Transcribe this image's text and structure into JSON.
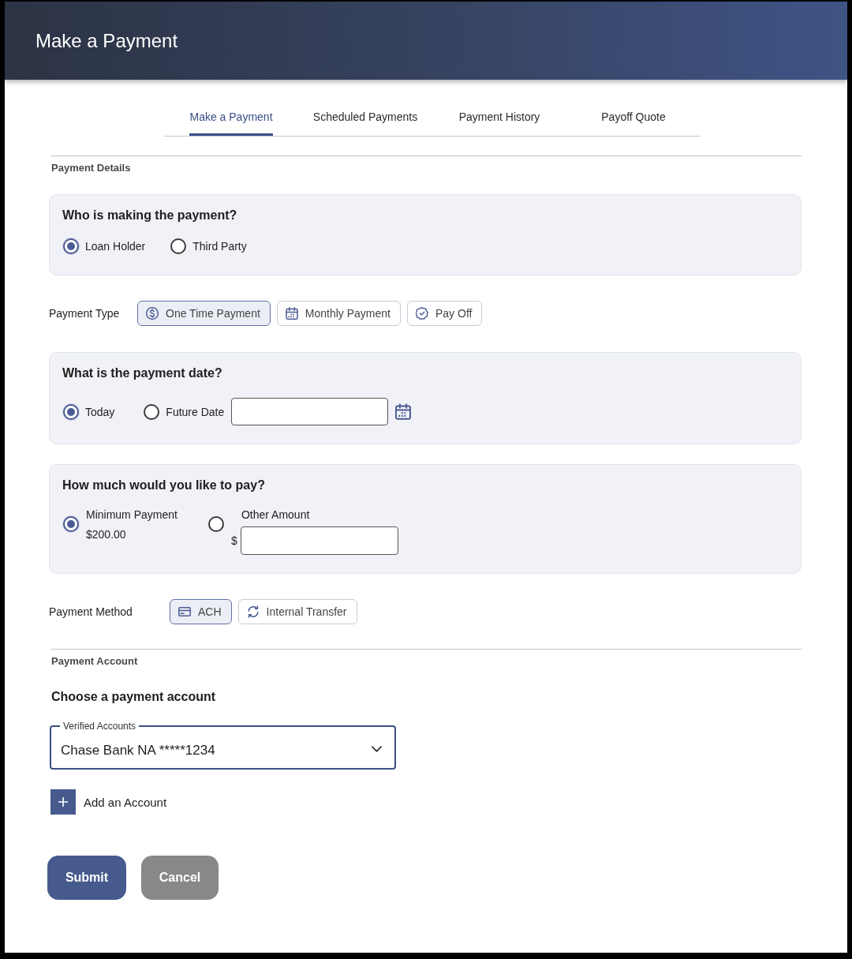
{
  "header": {
    "title": "Make a Payment"
  },
  "tabs": [
    {
      "label": "Make a Payment",
      "selected": true
    },
    {
      "label": "Scheduled Payments",
      "selected": false
    },
    {
      "label": "Payment History",
      "selected": false
    },
    {
      "label": "Payoff Quote",
      "selected": false
    }
  ],
  "payment_details": {
    "heading": "Payment Details",
    "payer": {
      "question": "Who is making the payment?",
      "options": [
        {
          "label": "Loan Holder",
          "selected": true
        },
        {
          "label": "Third Party",
          "selected": false
        }
      ]
    },
    "payment_type": {
      "label": "Payment Type",
      "options": [
        {
          "label": "One Time Payment",
          "selected": true
        },
        {
          "label": "Monthly Payment",
          "selected": false
        },
        {
          "label": "Pay Off",
          "selected": false
        }
      ]
    },
    "payment_date": {
      "question": "What is the payment date?",
      "options": [
        {
          "kind": "plain",
          "label": "Today",
          "selected": true
        },
        {
          "kind": "date",
          "label": "Future Date",
          "selected": false
        }
      ]
    },
    "amount": {
      "question": "How much would you like to pay?",
      "options": [
        {
          "kind": "value",
          "label": "Minimum Payment",
          "amount": "$200.00",
          "selected": true
        },
        {
          "kind": "input",
          "label": "Other Amount",
          "currency": "$",
          "selected": false
        }
      ]
    },
    "payment_method": {
      "label": "Payment Method",
      "options": [
        {
          "label": "ACH",
          "selected": true
        },
        {
          "label": "Internal Transfer",
          "selected": false
        }
      ]
    }
  },
  "payment_account": {
    "heading": "Payment Account",
    "prompt": "Choose a payment account",
    "account_select": {
      "label": "Verified Accounts",
      "value": "Chase Bank NA *****1234",
      "focused": true
    },
    "add_account": {
      "label": "Add an Account"
    }
  },
  "actions": [
    {
      "kind": "primary",
      "label": "Submit"
    },
    {
      "kind": "secondary",
      "label": "Cancel"
    }
  ]
}
